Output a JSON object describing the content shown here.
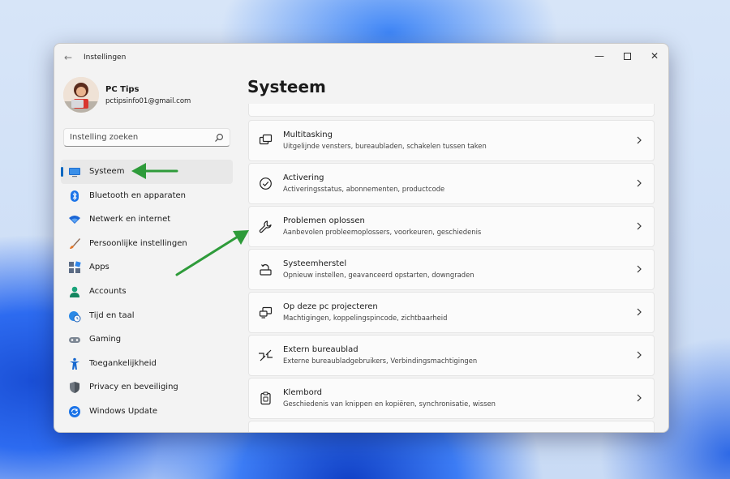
{
  "window": {
    "title": "Instellingen",
    "back_glyph": "←",
    "minimize_glyph": "—",
    "close_glyph": "✕"
  },
  "profile": {
    "name": "PC Tips",
    "email": "pctipsinfo01@gmail.com"
  },
  "search": {
    "placeholder": "Instelling zoeken"
  },
  "sidebar": {
    "items": [
      {
        "label": "Systeem",
        "icon": "system-icon",
        "active": true
      },
      {
        "label": "Bluetooth en apparaten",
        "icon": "bluetooth-icon"
      },
      {
        "label": "Netwerk en internet",
        "icon": "wifi-icon"
      },
      {
        "label": "Persoonlijke instellingen",
        "icon": "brush-icon"
      },
      {
        "label": "Apps",
        "icon": "apps-icon"
      },
      {
        "label": "Accounts",
        "icon": "person-icon"
      },
      {
        "label": "Tijd en taal",
        "icon": "globe-clock-icon"
      },
      {
        "label": "Gaming",
        "icon": "gamepad-icon"
      },
      {
        "label": "Toegankelijkheid",
        "icon": "accessibility-icon"
      },
      {
        "label": "Privacy en beveiliging",
        "icon": "shield-icon"
      },
      {
        "label": "Windows Update",
        "icon": "update-icon"
      }
    ]
  },
  "main": {
    "title": "Systeem",
    "cards": [
      {
        "title": "Multitasking",
        "desc": "Uitgelijnde vensters, bureaubladen, schakelen tussen taken",
        "icon": "multitasking-icon"
      },
      {
        "title": "Activering",
        "desc": "Activeringsstatus, abonnementen, productcode",
        "icon": "check-circle-icon"
      },
      {
        "title": "Problemen oplossen",
        "desc": "Aanbevolen probleemoplossers, voorkeuren, geschiedenis",
        "icon": "wrench-icon"
      },
      {
        "title": "Systeemherstel",
        "desc": "Opnieuw instellen, geavanceerd opstarten, downgraden",
        "icon": "recovery-icon"
      },
      {
        "title": "Op deze pc projecteren",
        "desc": "Machtigingen, koppelingspincode, zichtbaarheid",
        "icon": "project-icon"
      },
      {
        "title": "Extern bureaublad",
        "desc": "Externe bureaubladgebruikers, Verbindingsmachtigingen",
        "icon": "remote-desktop-icon"
      },
      {
        "title": "Klembord",
        "desc": "Geschiedenis van knippen en kopiëren, synchronisatie, wissen",
        "icon": "clipboard-icon"
      }
    ]
  },
  "colors": {
    "accent": "#0067c0",
    "annotation_arrow": "#2e9b3a"
  }
}
